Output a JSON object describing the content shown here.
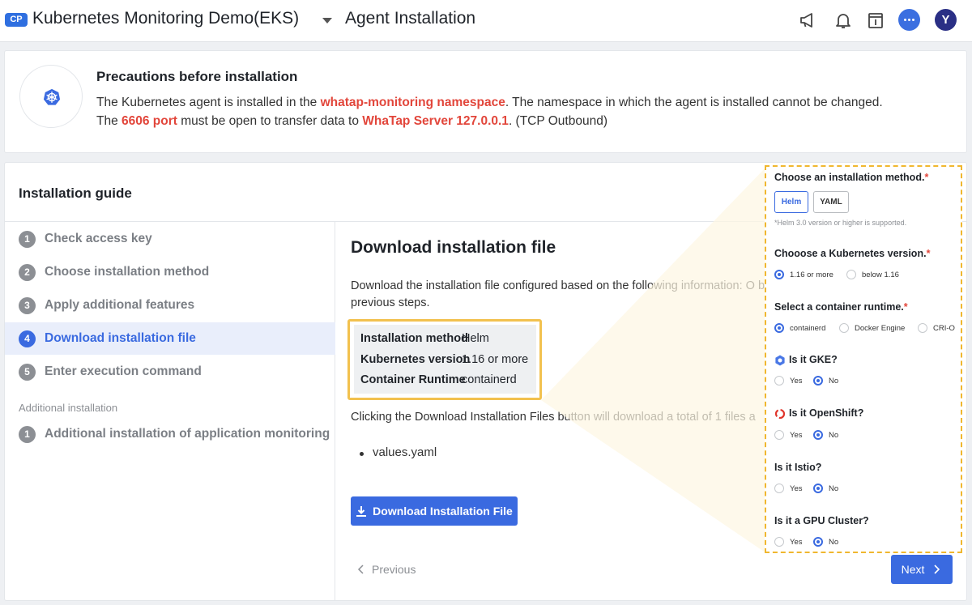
{
  "header": {
    "badge": "CP",
    "project_name": "Kubernetes Monitoring Demo(EKS)",
    "page_title": "Agent Installation",
    "avatar_initial": "Y"
  },
  "precautions": {
    "title": "Precautions before installation",
    "line1_pre": "The Kubernetes agent is installed in the ",
    "line1_highlight": "whatap-monitoring namespace",
    "line1_post": ". The namespace in which the agent is installed cannot be changed.",
    "line2_pre": "The ",
    "line2_highlight1": "6606 port",
    "line2_mid": " must be open to transfer data to ",
    "line2_highlight2": "WhaTap Server 127.0.0.1",
    "line2_post": ". (TCP Outbound)"
  },
  "guide": {
    "title": "Installation guide",
    "steps": [
      {
        "num": "1",
        "label": "Check access key"
      },
      {
        "num": "2",
        "label": "Choose installation method"
      },
      {
        "num": "3",
        "label": "Apply additional features"
      },
      {
        "num": "4",
        "label": "Download installation file"
      },
      {
        "num": "5",
        "label": "Enter execution command"
      }
    ],
    "additional_title": "Additional installation",
    "additional_steps": [
      {
        "num": "1",
        "label": "Additional installation of application monitoring"
      }
    ]
  },
  "main": {
    "title": "Download installation file",
    "desc": "Download the installation file configured based on the following information: O back to previous steps.",
    "info": {
      "method_key": "Installation method",
      "method_val": "Helm",
      "k8s_key": "Kubernetes version",
      "k8s_val": "1.16 or more",
      "runtime_key": "Container Runtime",
      "runtime_val": "containerd"
    },
    "click_desc": "Clicking the Download Installation Files button will download a total of 1 files a",
    "files": [
      "values.yaml"
    ],
    "download_button": "Download Installation File",
    "previous": "Previous",
    "next": "Next"
  },
  "panel": {
    "method_label": "Choose an installation method.",
    "method_options": [
      "Helm",
      "YAML"
    ],
    "method_note": "*Helm 3.0 version or higher is supported.",
    "k8s_label": "Chooose a Kubernetes version.",
    "k8s_options": [
      "1.16 or more",
      "below 1.16"
    ],
    "runtime_label": "Select a container runtime.",
    "runtime_options": [
      "containerd",
      "Docker Engine",
      "CRI-O"
    ],
    "gke_label": "Is it GKE?",
    "openshift_label": "Is it OpenShift?",
    "istio_label": "Is it Istio?",
    "gpu_label": "Is it a GPU Cluster?",
    "yes": "Yes",
    "no": "No",
    "required_mark": "*"
  },
  "colors": {
    "accent": "#3a6ae0",
    "highlight_red": "#e2463b",
    "callout_yellow": "#f2c14e"
  }
}
